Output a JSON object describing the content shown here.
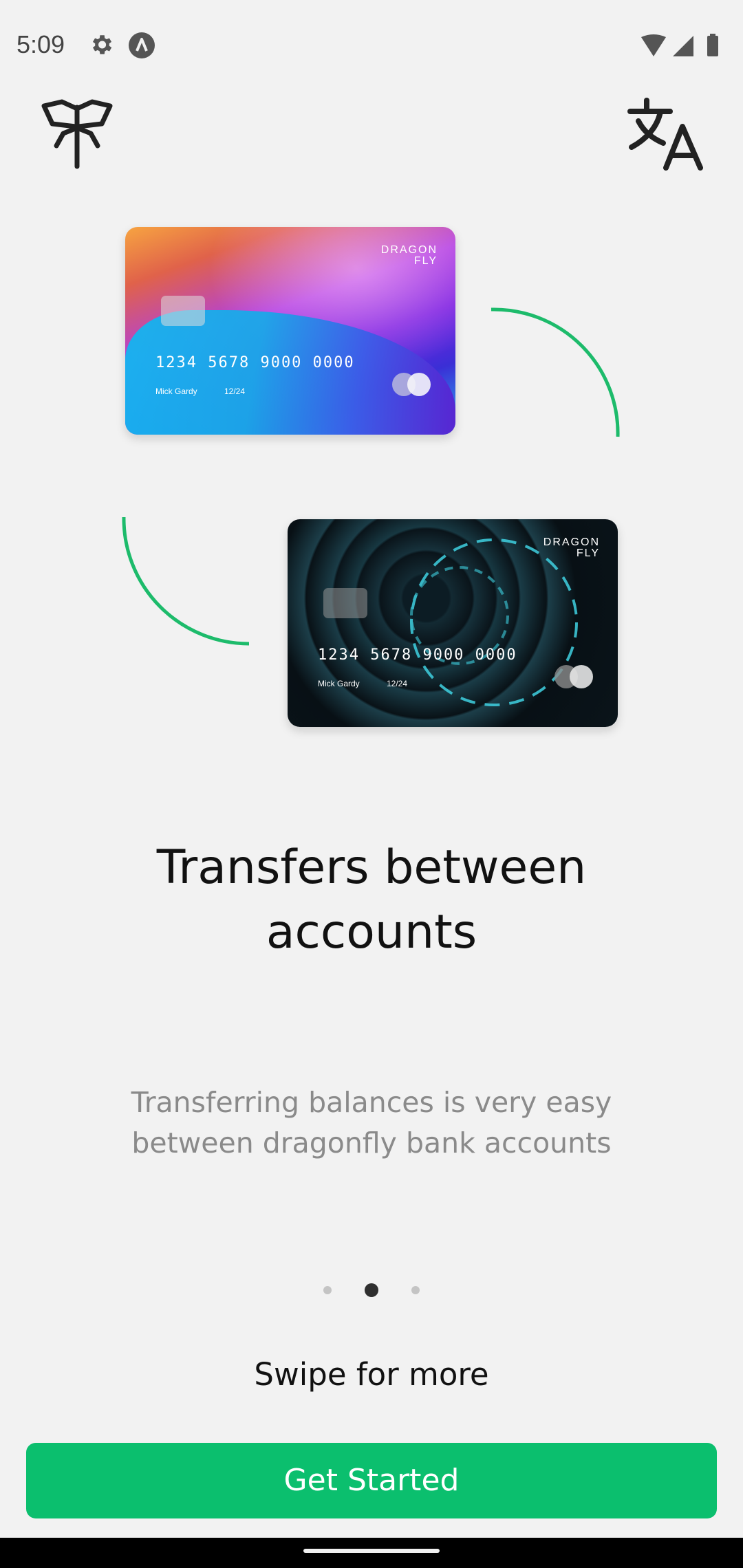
{
  "status_bar": {
    "time": "5:09",
    "left_icons": [
      "gear-icon",
      "a-circle-icon"
    ],
    "right_icons": [
      "wifi-icon",
      "cell-signal-icon",
      "battery-icon"
    ]
  },
  "top_bar": {
    "logo_icon": "dragonfly-logo-icon",
    "translate_icon": "translate-icon"
  },
  "illustration": {
    "card1": {
      "brand_line1": "DRAGON",
      "brand_line2": "FLY",
      "number": "1234 5678 9000 0000",
      "holder": "Mick Gardy",
      "expiry": "12/24"
    },
    "card2": {
      "brand_line1": "DRAGON",
      "brand_line2": "FLY",
      "number": "1234 5678 9000 0000",
      "holder": "Mick Gardy",
      "expiry": "12/24"
    },
    "arc_color": "#1dbb6b"
  },
  "onboarding": {
    "title": "Transfers between accounts",
    "subtitle": "Transferring balances is very easy between dragonfly bank accounts",
    "page_count": 3,
    "active_page": 2,
    "swipe_hint": "Swipe for more",
    "cta_label": "Get Started"
  },
  "colors": {
    "accent": "#0bbf6e",
    "background": "#f2f2f2",
    "title_text": "#111111",
    "subtitle_text": "#8a8a8a"
  }
}
